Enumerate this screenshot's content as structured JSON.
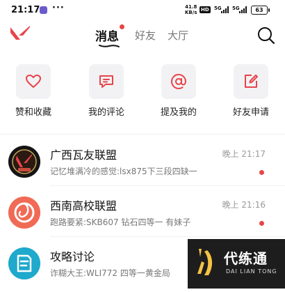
{
  "status_bar": {
    "time": "21:17",
    "more": "···",
    "net_speed": "41.8",
    "net_unit": "KB/s",
    "hd": "HD",
    "sig1": "5G",
    "sig2": "5G",
    "battery": "63"
  },
  "header": {
    "tabs": [
      {
        "label": "消息",
        "active": true
      },
      {
        "label": "好友",
        "active": false
      },
      {
        "label": "大厅",
        "active": false
      }
    ]
  },
  "shortcuts": [
    {
      "label": "赞和收藏",
      "icon": "heart-icon"
    },
    {
      "label": "我的评论",
      "icon": "comment-icon"
    },
    {
      "label": "提及我的",
      "icon": "at-icon"
    },
    {
      "label": "好友申请",
      "icon": "edit-icon"
    }
  ],
  "conversations": [
    {
      "title": "广西瓦友联盟",
      "preview": "记忆堆满冷的感觉:lsx875下三段四缺一",
      "time": "晚上 21:17",
      "unread": true
    },
    {
      "title": "西南高校联盟",
      "preview": "跑路要紧:SKB607 钻石四等一 有妹子",
      "time": "晚上 21:16",
      "unread": true
    },
    {
      "title": "攻略讨论",
      "preview": "诈糊大王:WLI772 四等一黄金局",
      "time": "",
      "unread": false
    }
  ],
  "watermark": {
    "main": "代练通",
    "sub": "DAI LIAN TONG"
  },
  "colors": {
    "accent": "#e8444a",
    "muted": "#777777"
  }
}
